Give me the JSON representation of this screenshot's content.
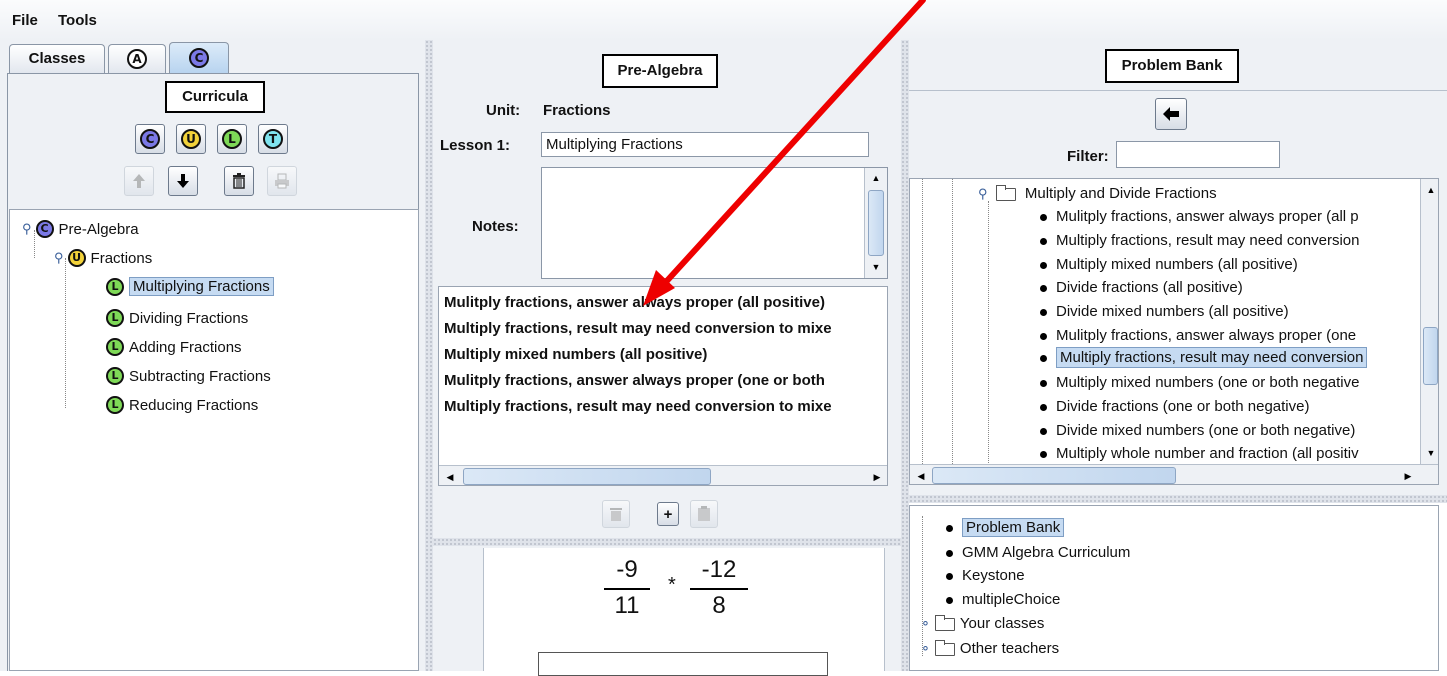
{
  "menu": {
    "file": "File",
    "tools": "Tools"
  },
  "tabs": {
    "classes": "Classes",
    "assignments": "A",
    "curricula": "C"
  },
  "curricula": {
    "heading": "Curricula",
    "buttons": [
      "C",
      "U",
      "L",
      "T"
    ],
    "tree": {
      "course": "Pre-Algebra",
      "unit": "Fractions",
      "lessons": [
        "Multiplying Fractions",
        "Dividing Fractions",
        "Adding Fractions",
        "Subtracting Fractions",
        "Reducing Fractions"
      ]
    }
  },
  "lesson_panel": {
    "heading": "Pre-Algebra",
    "unit_label": "Unit:",
    "unit_value": "Fractions",
    "lesson_label": "Lesson 1:",
    "lesson_value": "Multiplying Fractions",
    "notes_label": "Notes:",
    "notes_value": "",
    "problems": [
      "Mulitply fractions, answer always proper (all positive)",
      "Multiply fractions, result may need conversion to mixe",
      "Multiply mixed numbers (all positive)",
      "Mulitply fractions, answer always proper (one or both",
      "Multiply fractions, result may need conversion to mixe"
    ],
    "add_label": "+",
    "preview": {
      "num1": "-9",
      "den1": "11",
      "op": "*",
      "num2": "-12",
      "den2": "8"
    }
  },
  "problem_bank": {
    "heading": "Problem Bank",
    "filter_label": "Filter:",
    "filter_value": "",
    "folder": "Multiply and Divide Fractions",
    "items": [
      "Mulitply fractions, answer always proper (all p",
      "Multiply fractions, result may need conversion",
      "Multiply mixed numbers (all positive)",
      "Divide fractions (all positive)",
      "Divide mixed numbers (all positive)",
      "Mulitply fractions, answer always proper (one",
      "Multiply fractions, result may need conversion",
      "Multiply mixed numbers (one or both negative",
      "Divide fractions (one or both negative)",
      "Divide mixed numbers (one or both negative)",
      "Multiply whole number and fraction (all positiv"
    ],
    "sources": [
      "Problem Bank",
      "GMM Algebra Curriculum",
      "Keystone",
      "multipleChoice"
    ],
    "folders": [
      "Your classes",
      "Other teachers"
    ]
  },
  "colors": {
    "selection": "#c6dbf2",
    "arrow": "#ee0000",
    "circle_c": "#7b79e6",
    "circle_u": "#f2d23a",
    "circle_l": "#7ed957",
    "circle_t": "#7fe3ee"
  }
}
